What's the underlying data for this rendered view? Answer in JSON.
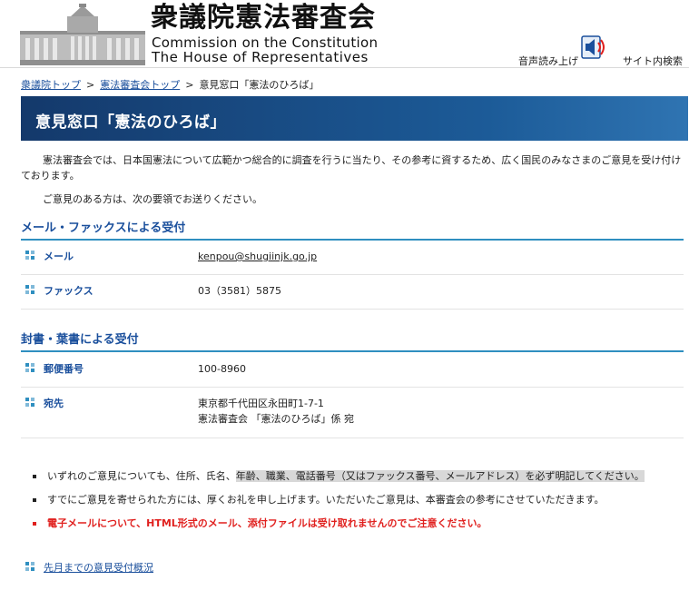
{
  "header": {
    "title_jp": "衆議院憲法審査会",
    "title_en_1": "Commission on the Constitution",
    "title_en_2": "The House of  Representatives",
    "voice_label": "音声読み上げ",
    "search_label": "サイト内検索"
  },
  "breadcrumb": {
    "items": [
      "衆議院トップ",
      "憲法審査会トップ"
    ],
    "current": "意見窓口「憲法のひろば」",
    "separator": ">"
  },
  "page": {
    "title": "意見窓口「憲法のひろば」",
    "intro": "憲法審査会では、日本国憲法について広範かつ総合的に調査を行うに当たり、その参考に資するため、広く国民のみなさまのご意見を受け付けております。",
    "intro2": "ご意見のある方は、次の要領でお送りください。"
  },
  "section_mail_fax": {
    "heading": "メール・ファックスによる受付",
    "mail_label": "メール",
    "mail_value": "kenpou@shugiinjk.go.jp",
    "fax_label": "ファックス",
    "fax_value": "03（3581）5875"
  },
  "section_post": {
    "heading": "封書・葉書による受付",
    "zip_label": "郵便番号",
    "zip_value": "100-8960",
    "addr_label": "宛先",
    "addr_line1": "東京都千代田区永田町1-7-1",
    "addr_line2": "憲法審査会 「憲法のひろば」係 宛"
  },
  "notes": {
    "note1_a": "いずれのご意見についても、住所、氏名、",
    "note1_b": "年齢、職業、電話番号（又はファックス番号、メールアドレス）を必ず明記してください。",
    "note2": "すでにご意見を寄せられた方には、厚くお礼を申し上げます。いただいたご意見は、本審査会の参考にさせていただきます。",
    "note3": "電子メールについて、HTML形式のメール、添付ファイルは受け取れませんのでご注意ください。"
  },
  "footer": {
    "link": "先月までの意見受付概況"
  },
  "colors": {
    "accent": "#1a4f9c",
    "rule": "#2f8fc0",
    "warning": "#e0201e"
  }
}
